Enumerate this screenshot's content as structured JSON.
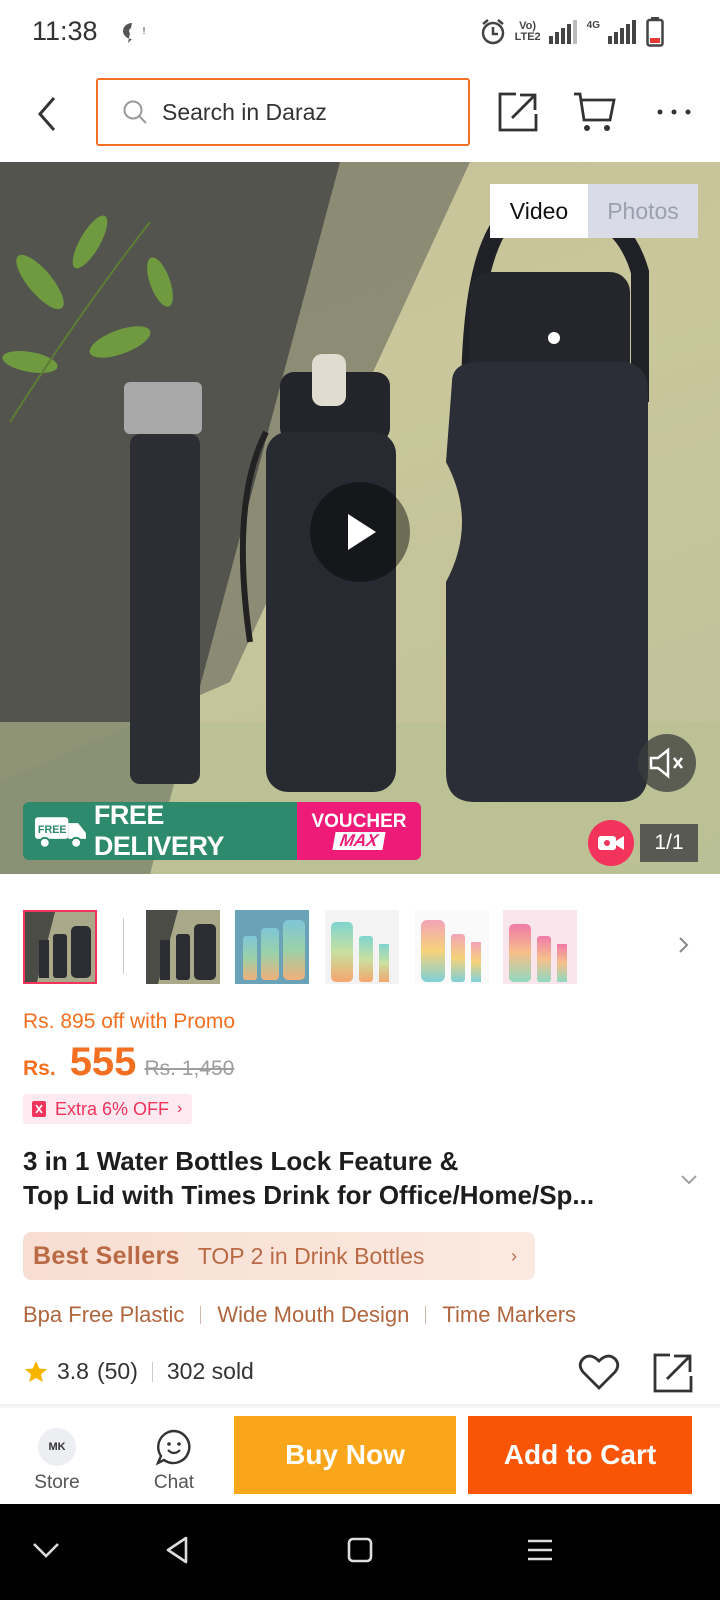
{
  "status_bar": {
    "time": "11:38",
    "network_label_top": "Vo)",
    "network_label_bottom": "LTE2",
    "network_type": "4G",
    "icons": [
      "chat-notification-icon",
      "alarm-icon",
      "signal-icon",
      "battery-icon"
    ]
  },
  "nav": {
    "search_placeholder": "Search in Daraz",
    "icons": [
      "back-icon",
      "search-icon",
      "share-icon",
      "cart-icon",
      "more-icon"
    ]
  },
  "media": {
    "tab_video": "Video",
    "tab_photos": "Photos",
    "delivery_text": "FREE DELIVERY",
    "free_tag": "FREE",
    "voucher_top": "VOUCHER",
    "voucher_bottom": "MAX",
    "counter": "1/1",
    "icons": [
      "play-icon",
      "mute-icon",
      "video-camera-icon"
    ]
  },
  "thumbnails": {
    "count": 6,
    "selected_index": 0
  },
  "price": {
    "promo": "Rs. 895 off with Promo",
    "currency": "Rs.",
    "current": "555",
    "original": "Rs. 1,450",
    "extra": "Extra 6% OFF"
  },
  "product": {
    "title_line1": "3 in 1 Water Bottles Lock Feature &",
    "title_line2": "Top Lid with Times Drink for Office/Home/Sp..."
  },
  "best_sellers": {
    "label": "Best Sellers",
    "text": "TOP 2 in Drink Bottles"
  },
  "features": [
    "Bpa Free Plastic",
    "Wide Mouth Design",
    "Time Markers"
  ],
  "rating": {
    "score": "3.8",
    "count": "(50)",
    "sold": "302 sold"
  },
  "actions": {
    "store_logo": "MK",
    "store_label": "Store",
    "chat_label": "Chat",
    "buy_now": "Buy Now",
    "add_to_cart": "Add to Cart"
  },
  "colors": {
    "accent_orange": "#f85606",
    "buy_yellow": "#faa61a",
    "promo_orange": "#f36f21",
    "pink": "#f2335c",
    "delivery_green": "#2e8a6c"
  }
}
